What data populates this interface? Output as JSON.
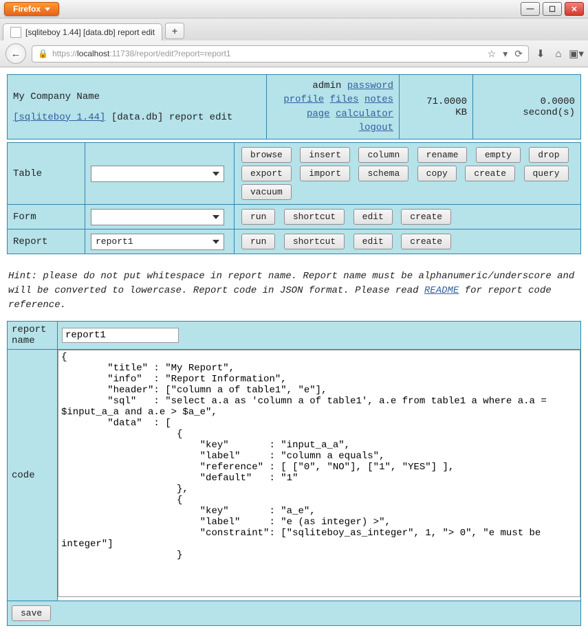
{
  "browser": {
    "label": "Firefox",
    "tab_title": "[sqliteboy 1.44] [data.db] report edit",
    "url_host": "localhost",
    "url_port": ":11738",
    "url_path": "/report/edit?report=report1",
    "url_scheme": "https://"
  },
  "header": {
    "company": "My Company Name",
    "app_link": "[sqliteboy 1.44]",
    "db": "[data.db]",
    "page": "report edit",
    "user": "admin",
    "links": {
      "password": "password",
      "profile": "profile",
      "files": "files",
      "notes": "notes",
      "page": "page",
      "calculator": "calculator",
      "logout": "logout"
    },
    "size_value": "71.0000",
    "size_unit": "KB",
    "time_value": "0.0000",
    "time_unit": "second(s)"
  },
  "actions": {
    "table_label": "Table",
    "form_label": "Form",
    "report_label": "Report",
    "report_selected": "report1",
    "table_buttons": [
      "browse",
      "insert",
      "column",
      "rename",
      "empty",
      "drop",
      "export",
      "import",
      "schema",
      "copy",
      "create",
      "query",
      "vacuum"
    ],
    "form_buttons": [
      "run",
      "shortcut",
      "edit",
      "create"
    ],
    "report_buttons": [
      "run",
      "shortcut",
      "edit",
      "create"
    ]
  },
  "hint": {
    "text1": "Hint: please do not put whitespace in report name. Report name must be alphanumeric/underscore and will be converted to lowercase. Report code in JSON format. Please read ",
    "readme": "README",
    "text2": " for report code reference."
  },
  "form": {
    "name_label": "report\nname",
    "code_label": "code",
    "name_value": "report1",
    "code_value": "{\n        \"title\" : \"My Report\",\n        \"info\"  : \"Report Information\",\n        \"header\": [\"column a of table1\", \"e\"],\n        \"sql\"   : \"select a.a as 'column a of table1', a.e from table1 a where a.a = $input_a_a and a.e > $a_e\",\n        \"data\"  : [\n                    {\n                        \"key\"       : \"input_a_a\",\n                        \"label\"     : \"column a equals\",\n                        \"reference\" : [ [\"0\", \"NO\"], [\"1\", \"YES\"] ],\n                        \"default\"   : \"1\"\n                    },\n                    {\n                        \"key\"       : \"a_e\",\n                        \"label\"     : \"e (as integer) >\",\n                        \"constraint\": [\"sqliteboy_as_integer\", 1, \"> 0\", \"e must be integer\"]\n                    }\n",
    "save": "save"
  }
}
